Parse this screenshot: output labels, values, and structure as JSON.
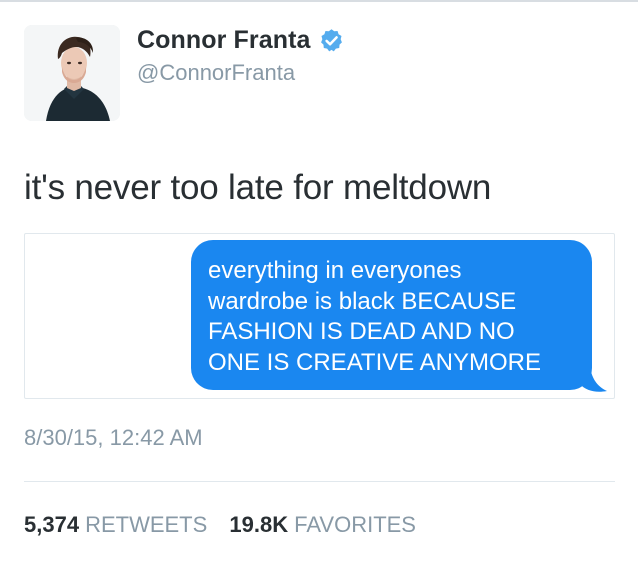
{
  "user": {
    "display_name": "Connor Franta",
    "handle": "@ConnorFranta",
    "verified_icon": "verified-badge-icon"
  },
  "tweet": {
    "text": "it's never too late for meltdown",
    "timestamp": "8/30/15, 12:42 AM"
  },
  "media": {
    "message_lines": [
      "everything in everyones",
      "wardrobe is black BECAUSE",
      "FASHION IS DEAD AND NO",
      "ONE IS CREATIVE ANYMORE"
    ],
    "bubble_color": "#1a87f0"
  },
  "stats": {
    "retweets_count": "5,374",
    "retweets_label": "RETWEETS",
    "favorites_count": "19.8K",
    "favorites_label": "FAVORITES"
  },
  "colors": {
    "verified": "#55acee",
    "muted": "#8899a6",
    "text": "#292f33"
  }
}
